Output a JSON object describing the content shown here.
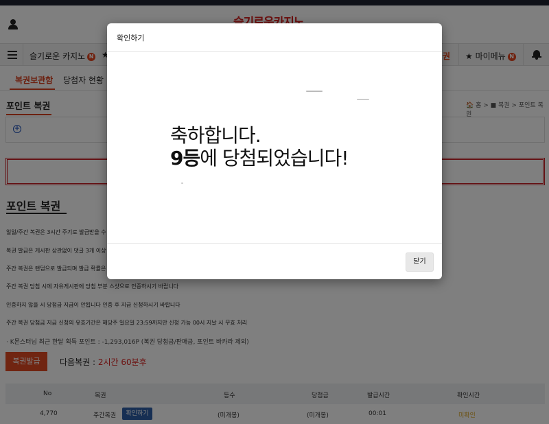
{
  "header": {
    "logo_text": "슬기로운카지노"
  },
  "nav": {
    "site_name": "슬기로운 카지노",
    "new_badge": "N",
    "star": "★",
    "partial_right_item": "권",
    "mymenu": "★ 마이메뉴"
  },
  "subtabs": [
    {
      "label": "복권보관함"
    },
    {
      "label": "당첨자 현황"
    }
  ],
  "section": {
    "title": "포인트 복권"
  },
  "breadcrumb": "🏠 홈 > ■ 복권 > 포인트 복권",
  "page_title": "포인트 복권",
  "rules": [
    "일일/주간 복권은 3시간 주기로 발급받을 수",
    "복권 발급은 게시판 상관없이 댓글 3개 이상",
    "주간 복권은 랜덤으로 발급되며 발급 확률은",
    "주간 복권 당첨 시에 자유게시판에 당첨 부분 스샷으로 인증하시기 바랍니다",
    "인증하지 않을 시 당첨금 지급이 안됩니다 인증 후 지급 신청하시기 바랍니다",
    "주간 복권 당첨금 지급 신청의 유효기간은 해당주 일요일 23:59까지만 신청 가능 00시 지날 시 무효 처리"
  ],
  "points_line": "· K몬스터님 최근 한달 획득 포인트 : -1,293,016P (복권 당첨금/판매금, 포인트 바카라 제외)",
  "issue_button": "복권발급",
  "next_lottery": {
    "label": "다음복권 : ",
    "value": "2시간 60분후"
  },
  "table": {
    "headers": [
      "No",
      "복권",
      "등수",
      "당첨금",
      "발급시간",
      "확인시간"
    ],
    "rows": [
      {
        "no": "4,770",
        "name": "주간복권",
        "confirm": "확인하기",
        "rank": "(미개봉)",
        "prize": "(미개봉)",
        "issued": "00:01",
        "checked": "미확인"
      }
    ]
  },
  "modal": {
    "title": "확인하기",
    "message_line1": "축하합니다.",
    "message_rank": "9등",
    "message_rest": "에 당첨되었습니다!",
    "close_button": "닫기"
  },
  "colors": {
    "accent": "#d9401f",
    "brand": "#d9201f",
    "confirm_chip": "#2f5fa6"
  }
}
